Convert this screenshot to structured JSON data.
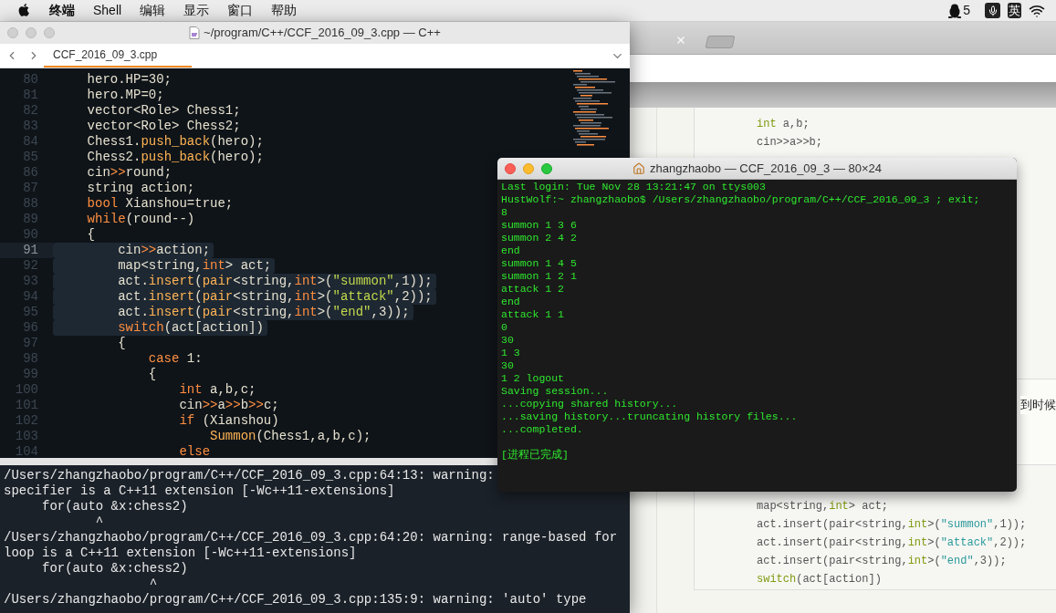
{
  "menu_bar": {
    "items": [
      "终端",
      "Shell",
      "编辑",
      "显示",
      "窗口",
      "帮助"
    ],
    "status": {
      "notification_count": "5",
      "input_method": "英"
    }
  },
  "browser": {
    "code_top": [
      [
        {
          "text": "int",
          "kind": "kw"
        },
        {
          "text": " a,b;",
          "kind": "plain"
        }
      ],
      [
        {
          "text": "cin>>a>>b;",
          "kind": "plain"
        }
      ]
    ],
    "paragraph_fragment": "到时候",
    "code_bottom": [
      [
        {
          "text": "map<string,",
          "kind": "plain"
        },
        {
          "text": "int",
          "kind": "kw"
        },
        {
          "text": "> act;",
          "kind": "plain"
        }
      ],
      [
        {
          "text": "act.insert(pair<string,",
          "kind": "plain"
        },
        {
          "text": "int",
          "kind": "kw"
        },
        {
          "text": ">(",
          "kind": "plain"
        },
        {
          "text": "\"summon\"",
          "kind": "str"
        },
        {
          "text": ",1));",
          "kind": "plain"
        }
      ],
      [
        {
          "text": "act.insert(pair<string,",
          "kind": "plain"
        },
        {
          "text": "int",
          "kind": "kw"
        },
        {
          "text": ">(",
          "kind": "plain"
        },
        {
          "text": "\"attack\"",
          "kind": "str"
        },
        {
          "text": ",2));",
          "kind": "plain"
        }
      ],
      [
        {
          "text": "act.insert(pair<string,",
          "kind": "plain"
        },
        {
          "text": "int",
          "kind": "kw"
        },
        {
          "text": ">(",
          "kind": "plain"
        },
        {
          "text": "\"end\"",
          "kind": "str"
        },
        {
          "text": ",3));",
          "kind": "plain"
        }
      ],
      [
        {
          "text": "switch",
          "kind": "kw"
        },
        {
          "text": "(act[action])",
          "kind": "plain"
        }
      ]
    ]
  },
  "editor": {
    "title": "~/program/C++/CCF_2016_09_3.cpp — C++",
    "tab": {
      "label": "CCF_2016_09_3.cpp",
      "selected": true
    },
    "lines": [
      {
        "number": "80",
        "selected": false,
        "current": false,
        "tokens": [
          {
            "text": "    hero.HP=30;",
            "kind": "plain"
          }
        ]
      },
      {
        "number": "81",
        "selected": false,
        "current": false,
        "tokens": [
          {
            "text": "    hero.MP=0;",
            "kind": "plain"
          }
        ]
      },
      {
        "number": "82",
        "selected": false,
        "current": false,
        "tokens": [
          {
            "text": "    vector<Role> Chess1;",
            "kind": "plain"
          }
        ]
      },
      {
        "number": "83",
        "selected": false,
        "current": false,
        "tokens": [
          {
            "text": "    vector<Role> Chess2;",
            "kind": "plain"
          }
        ]
      },
      {
        "number": "84",
        "selected": false,
        "current": false,
        "tokens": [
          {
            "text": "    Chess1.",
            "kind": "plain"
          },
          {
            "text": "push_back",
            "kind": "fn"
          },
          {
            "text": "(hero);",
            "kind": "plain"
          }
        ]
      },
      {
        "number": "85",
        "selected": false,
        "current": false,
        "tokens": [
          {
            "text": "    Chess2.",
            "kind": "plain"
          },
          {
            "text": "push_back",
            "kind": "fn"
          },
          {
            "text": "(hero);",
            "kind": "plain"
          }
        ]
      },
      {
        "number": "86",
        "selected": false,
        "current": false,
        "tokens": [
          {
            "text": "    cin",
            "kind": "plain"
          },
          {
            "text": ">>",
            "kind": "kw"
          },
          {
            "text": "round;",
            "kind": "plain"
          }
        ]
      },
      {
        "number": "87",
        "selected": false,
        "current": false,
        "tokens": [
          {
            "text": "    string action;",
            "kind": "plain"
          }
        ]
      },
      {
        "number": "88",
        "selected": false,
        "current": false,
        "tokens": [
          {
            "text": "    bool",
            "kind": "kw"
          },
          {
            "text": " Xianshou=true;",
            "kind": "plain"
          }
        ]
      },
      {
        "number": "89",
        "selected": false,
        "current": false,
        "tokens": [
          {
            "text": "    while",
            "kind": "kw"
          },
          {
            "text": "(round--)",
            "kind": "plain"
          }
        ]
      },
      {
        "number": "90",
        "selected": false,
        "current": false,
        "tokens": [
          {
            "text": "    {",
            "kind": "plain"
          }
        ]
      },
      {
        "number": "91",
        "selected": true,
        "current": true,
        "tokens": [
          {
            "text": "        cin",
            "kind": "plain"
          },
          {
            "text": ">>",
            "kind": "kw"
          },
          {
            "text": "action;",
            "kind": "plain"
          }
        ]
      },
      {
        "number": "92",
        "selected": true,
        "current": false,
        "tokens": [
          {
            "text": "        map<string,",
            "kind": "plain"
          },
          {
            "text": "int",
            "kind": "kw"
          },
          {
            "text": "> act;",
            "kind": "plain"
          }
        ]
      },
      {
        "number": "93",
        "selected": true,
        "current": false,
        "tokens": [
          {
            "text": "        act.",
            "kind": "plain"
          },
          {
            "text": "insert",
            "kind": "fn"
          },
          {
            "text": "(",
            "kind": "plain"
          },
          {
            "text": "pair",
            "kind": "fn"
          },
          {
            "text": "<string,",
            "kind": "plain"
          },
          {
            "text": "int",
            "kind": "kw"
          },
          {
            "text": ">(",
            "kind": "plain"
          },
          {
            "text": "\"summon\"",
            "kind": "str"
          },
          {
            "text": ",1));",
            "kind": "plain"
          }
        ]
      },
      {
        "number": "94",
        "selected": true,
        "current": false,
        "tokens": [
          {
            "text": "        act.",
            "kind": "plain"
          },
          {
            "text": "insert",
            "kind": "fn"
          },
          {
            "text": "(",
            "kind": "plain"
          },
          {
            "text": "pair",
            "kind": "fn"
          },
          {
            "text": "<string,",
            "kind": "plain"
          },
          {
            "text": "int",
            "kind": "kw"
          },
          {
            "text": ">(",
            "kind": "plain"
          },
          {
            "text": "\"attack\"",
            "kind": "str"
          },
          {
            "text": ",2));",
            "kind": "plain"
          }
        ]
      },
      {
        "number": "95",
        "selected": true,
        "current": false,
        "tokens": [
          {
            "text": "        act.",
            "kind": "plain"
          },
          {
            "text": "insert",
            "kind": "fn"
          },
          {
            "text": "(",
            "kind": "plain"
          },
          {
            "text": "pair",
            "kind": "fn"
          },
          {
            "text": "<string,",
            "kind": "plain"
          },
          {
            "text": "int",
            "kind": "kw"
          },
          {
            "text": ">(",
            "kind": "plain"
          },
          {
            "text": "\"end\"",
            "kind": "str"
          },
          {
            "text": ",3));",
            "kind": "plain"
          }
        ]
      },
      {
        "number": "96",
        "selected": true,
        "current": false,
        "tokens": [
          {
            "text": "        switch",
            "kind": "kw"
          },
          {
            "text": "(act[action])",
            "kind": "plain"
          }
        ]
      },
      {
        "number": "97",
        "selected": false,
        "current": false,
        "tokens": [
          {
            "text": "        {",
            "kind": "plain"
          }
        ]
      },
      {
        "number": "98",
        "selected": false,
        "current": false,
        "tokens": [
          {
            "text": "            case",
            "kind": "kw"
          },
          {
            "text": " 1:",
            "kind": "plain"
          }
        ]
      },
      {
        "number": "99",
        "selected": false,
        "current": false,
        "tokens": [
          {
            "text": "            {",
            "kind": "plain"
          }
        ]
      },
      {
        "number": "100",
        "selected": false,
        "current": false,
        "tokens": [
          {
            "text": "                int",
            "kind": "kw"
          },
          {
            "text": " a,b,c;",
            "kind": "plain"
          }
        ]
      },
      {
        "number": "101",
        "selected": false,
        "current": false,
        "tokens": [
          {
            "text": "                cin",
            "kind": "plain"
          },
          {
            "text": ">>",
            "kind": "kw"
          },
          {
            "text": "a",
            "kind": "plain"
          },
          {
            "text": ">>",
            "kind": "kw"
          },
          {
            "text": "b",
            "kind": "plain"
          },
          {
            "text": ">>",
            "kind": "kw"
          },
          {
            "text": "c;",
            "kind": "plain"
          }
        ]
      },
      {
        "number": "102",
        "selected": false,
        "current": false,
        "tokens": [
          {
            "text": "                if",
            "kind": "kw"
          },
          {
            "text": " (Xianshou)",
            "kind": "plain"
          }
        ]
      },
      {
        "number": "103",
        "selected": false,
        "current": false,
        "tokens": [
          {
            "text": "                    Summon",
            "kind": "fn"
          },
          {
            "text": "(Chess1,a,b,c);",
            "kind": "plain"
          }
        ]
      },
      {
        "number": "104",
        "selected": false,
        "current": false,
        "tokens": [
          {
            "text": "                else",
            "kind": "kw"
          }
        ]
      }
    ],
    "build_output": [
      "/Users/zhangzhaobo/program/C++/CCF_2016_09_3.cpp:64:13: warning:",
      "specifier is a C++11 extension [-Wc++11-extensions]",
      "     for(auto &x:chess2)",
      "            ^",
      "/Users/zhangzhaobo/program/C++/CCF_2016_09_3.cpp:64:20: warning: range-based for",
      "loop is a C++11 extension [-Wc++11-extensions]",
      "     for(auto &x:chess2)",
      "                   ^",
      "/Users/zhangzhaobo/program/C++/CCF_2016_09_3.cpp:135:9: warning: 'auto' type"
    ]
  },
  "terminal": {
    "title": "zhangzhaobo — CCF_2016_09_3 — 80×24",
    "lines": [
      {
        "text": "Last login: Tue Nov 28 13:21:47 on ttys003",
        "kind": "output"
      },
      {
        "text": "HustWolf:~ zhangzhaobo$ /Users/zhangzhaobo/program/C++/CCF_2016_09_3 ; exit;",
        "kind": "output"
      },
      {
        "text": "8",
        "kind": "output"
      },
      {
        "text": "summon 1 3 6",
        "kind": "output"
      },
      {
        "text": "summon 2 4 2",
        "kind": "output"
      },
      {
        "text": "end",
        "kind": "output"
      },
      {
        "text": "summon 1 4 5",
        "kind": "output"
      },
      {
        "text": "summon 1 2 1",
        "kind": "output"
      },
      {
        "text": "attack 1 2",
        "kind": "output"
      },
      {
        "text": "end",
        "kind": "output"
      },
      {
        "text": "attack 1 1",
        "kind": "output"
      },
      {
        "text": "0",
        "kind": "output"
      },
      {
        "text": "30",
        "kind": "output"
      },
      {
        "text": "1 3",
        "kind": "output"
      },
      {
        "text": "30",
        "kind": "output"
      },
      {
        "text": "1 2 logout",
        "kind": "output"
      },
      {
        "text": "Saving session...",
        "kind": "output"
      },
      {
        "text": "...copying shared history...",
        "kind": "output"
      },
      {
        "text": "...saving history...truncating history files...",
        "kind": "output"
      },
      {
        "text": "...completed.",
        "kind": "output"
      },
      {
        "text": "[进程已完成]",
        "kind": "status"
      }
    ]
  }
}
